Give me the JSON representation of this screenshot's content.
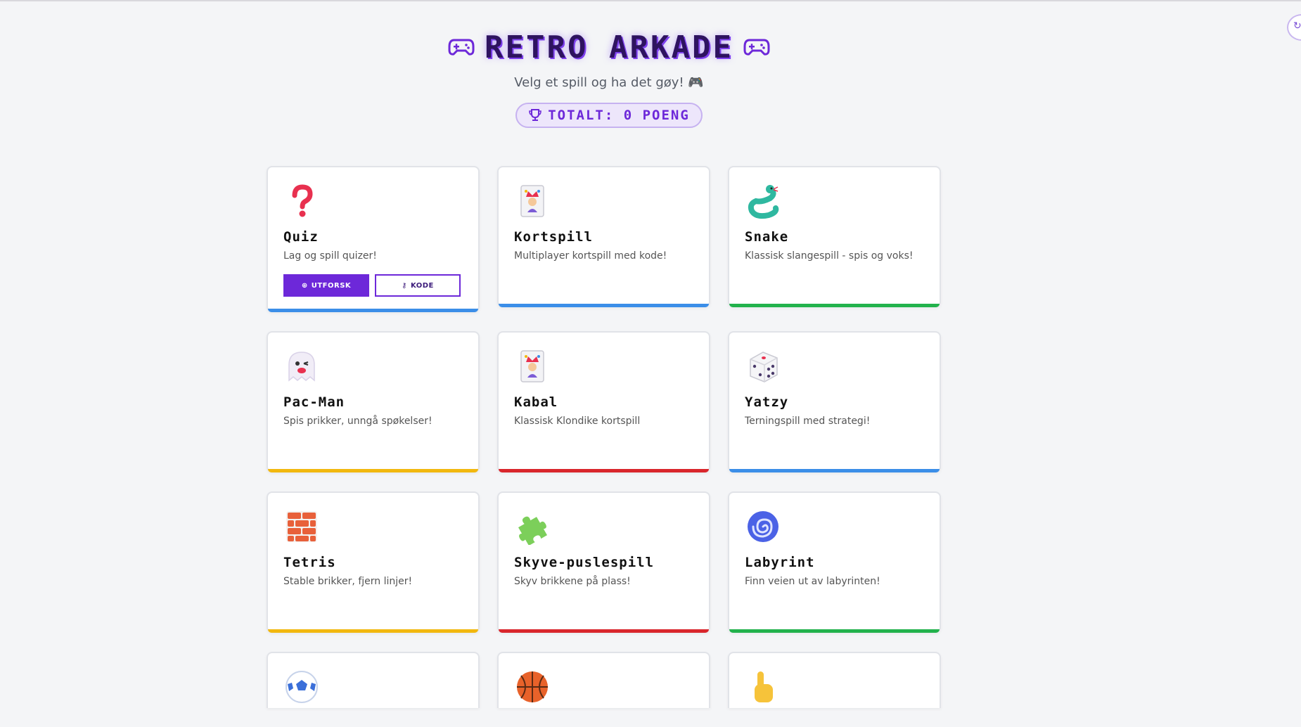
{
  "header": {
    "title": "RETRO ARKADE",
    "subtitle": "Velg et spill og ha det gøy! 🎮",
    "score_label": "TOTALT: 0 POENG"
  },
  "games": [
    {
      "name": "Quiz",
      "desc": "Lag og spill quizer!",
      "icon": "question-mark-icon",
      "color": "#3b8ee8",
      "buttons": {
        "explore": "UTFORSK",
        "code": "KODE"
      }
    },
    {
      "name": "Kortspill",
      "desc": "Multiplayer kortspill med kode!",
      "icon": "joker-card-icon",
      "color": "#3b8ee8"
    },
    {
      "name": "Snake",
      "desc": "Klassisk slangespill - spis og voks!",
      "icon": "snake-icon",
      "color": "#22b24c"
    },
    {
      "name": "Pac-Man",
      "desc": "Spis prikker, unngå spøkelser!",
      "icon": "ghost-icon",
      "color": "#f2b80f"
    },
    {
      "name": "Kabal",
      "desc": "Klassisk Klondike kortspill",
      "icon": "joker-card-icon",
      "color": "#d9262c"
    },
    {
      "name": "Yatzy",
      "desc": "Terningspill med strategi!",
      "icon": "dice-icon",
      "color": "#3b8ee8"
    },
    {
      "name": "Tetris",
      "desc": "Stable brikker, fjern linjer!",
      "icon": "brick-wall-icon",
      "color": "#f2b80f"
    },
    {
      "name": "Skyve-puslespill",
      "desc": "Skyv brikkene på plass!",
      "icon": "puzzle-piece-icon",
      "color": "#d9262c"
    },
    {
      "name": "Labyrint",
      "desc": "Finn veien ut av labyrinten!",
      "icon": "spiral-icon",
      "color": "#22b24c"
    }
  ],
  "partial_icons": [
    "soccer-ball-icon",
    "basketball-icon",
    "pointing-hand-icon"
  ]
}
